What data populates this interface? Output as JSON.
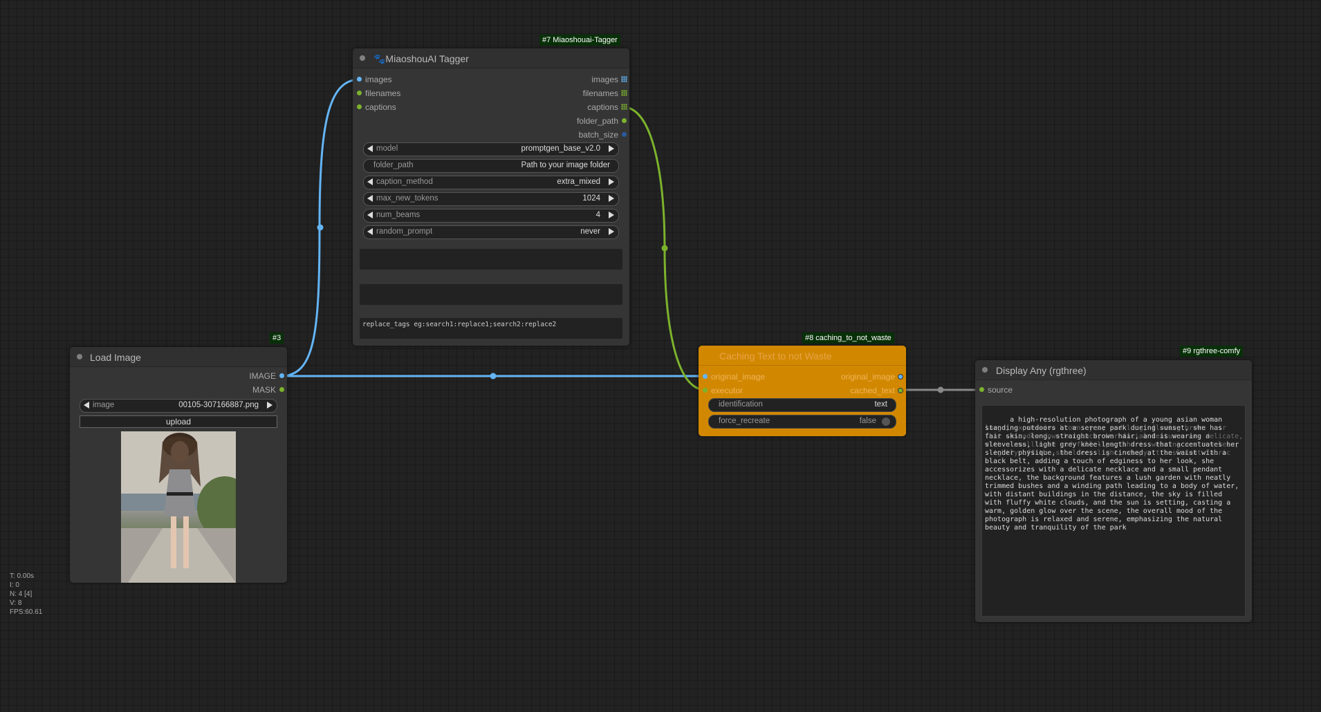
{
  "colors": {
    "image_link": "#64b5f6",
    "text_link": "#7cb32c",
    "any_link": "#888888",
    "caching_node": "#d18800",
    "badge_bg": "#083008"
  },
  "stats": {
    "time": "T: 0.00s",
    "iterations": "I: 0",
    "nodes": "N: 4 [4]",
    "vertices": "V: 8",
    "fps": "FPS:60.61"
  },
  "tagger": {
    "badge": "#7 Miaoshouai-Tagger",
    "title": "🐾MiaoshouAI Tagger",
    "inputs": {
      "images": "images",
      "filenames": "filenames",
      "captions": "captions"
    },
    "outputs": {
      "images": "images",
      "filenames": "filenames",
      "captions": "captions",
      "folder_path": "folder_path",
      "batch_size": "batch_size"
    },
    "widgets": {
      "model_label": "model",
      "model_value": "promptgen_base_v2.0",
      "folder_label": "folder_path",
      "folder_value": "Path to your image folder",
      "caption_label": "caption_method",
      "caption_value": "extra_mixed",
      "tokens_label": "max_new_tokens",
      "tokens_value": "1024",
      "beams_label": "num_beams",
      "beams_value": "4",
      "random_label": "random_prompt",
      "random_value": "never"
    },
    "replace_tags_placeholder": "replace_tags eg:search1:replace1;search2:replace2"
  },
  "load_image": {
    "badge": "#3",
    "title": "Load Image",
    "outputs": {
      "image": "IMAGE",
      "mask": "MASK"
    },
    "image_label": "image",
    "image_value": "00105-307166887.png",
    "upload_label": "upload"
  },
  "caching": {
    "badge": "#8 caching_to_not_waste",
    "title": "Caching Text to not Waste",
    "inputs": {
      "original_image": "original_image",
      "executor": "executor"
    },
    "outputs": {
      "original_image": "original_image",
      "cached_text": "cached_text"
    },
    "identification_label": "identification",
    "identification_value": "text",
    "force_label": "force_recreate",
    "force_value": "false"
  },
  "display_any": {
    "badge": "#9 rgthree-comfy",
    "title": "Display Any (rgthree)",
    "input_source": "source",
    "text": "a high-resolution photograph of a young asian woman standing outdoors at a serene park during sunset, she has fair skin, long, straight brown hair, and is wearing a sleeveless, light grey knee-length dress that accentuates her slender physique, the dress is cinched at the waist with a black belt, adding a touch of edginess to her look, she accessorizes with a delicate necklace and a small pendant necklace, the background features a lush garden with neatly trimmed bushes and a winding path leading to a body of water, with distant buildings in the distance, the sky is filled with fluffy white clouds, and the sun is setting, casting a warm, golden glow over the scene, the overall mood of the photograph is relaxed and serene, emphasizing the natural beauty and tranquility of the park",
    "overlap_text": "large, expressive brown eyes, and long, flowing brown hair that cascades down her back, her facial features are delicate, with a small nose and full lips, she is wearing a sleeveless, slightly off-the-shoulder, light, wispy, translucent fabric"
  }
}
